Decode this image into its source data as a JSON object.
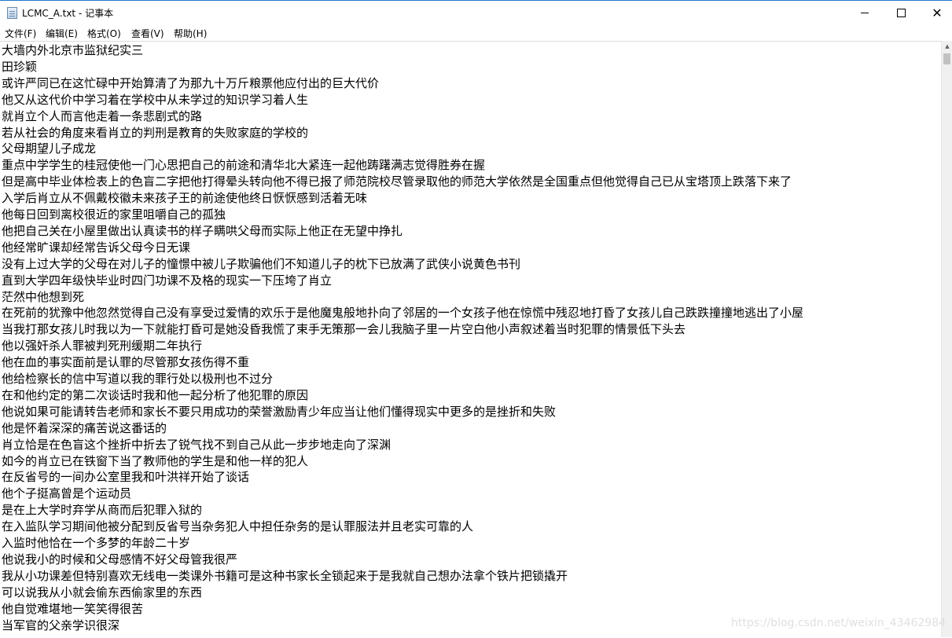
{
  "window": {
    "title": "LCMC_A.txt - 记事本",
    "icon": "notepad-icon",
    "controls": {
      "minimize": "minimize-icon",
      "maximize": "maximize-icon",
      "close": "✕"
    }
  },
  "menu": {
    "items": [
      {
        "label": "文件(F)"
      },
      {
        "label": "编辑(E)"
      },
      {
        "label": "格式(O)"
      },
      {
        "label": "查看(V)"
      },
      {
        "label": "帮助(H)"
      }
    ]
  },
  "editor": {
    "lines": [
      "大墙内外北京市监狱纪实三",
      "田珍颖",
      "或许严同已在这忙碌中开始算清了为那九十万斤粮票他应付出的巨大代价",
      "他又从这代价中学习着在学校中从未学过的知识学习着人生",
      "就肖立个人而言他走着一条悲剧式的路",
      "若从社会的角度来看肖立的判刑是教育的失败家庭的学校的",
      "父母期望儿子成龙",
      "重点中学学生的桂冠使他一门心思把自己的前途和清华北大紧连一起他踌躇满志觉得胜券在握",
      "但是高中毕业体检表上的色盲二字把他打得晕头转向他不得已报了师范院校尽管录取他的师范大学依然是全国重点但他觉得自己已从宝塔顶上跌落下来了",
      "入学后肖立从不佩戴校徽未来孩子王的前途使他终日恹恹感到活着无味",
      "他每日回到离校很近的家里咀嚼自己的孤独",
      "他把自己关在小屋里做出认真读书的样子瞒哄父母而实际上他正在无望中挣扎",
      "他经常旷课却经常告诉父母今日无课",
      "没有上过大学的父母在对儿子的憧憬中被儿子欺骗他们不知道儿子的枕下已放满了武侠小说黄色书刊",
      "直到大学四年级快毕业时四门功课不及格的现实一下压垮了肖立",
      "茫然中他想到死",
      "在死前的犹豫中他忽然觉得自己没有享受过爱情的欢乐于是他魔鬼般地扑向了邻居的一个女孩子他在惊慌中残忍地打昏了女孩儿自己跌跌撞撞地逃出了小屋",
      "当我打那女孩儿时我以为一下就能打昏可是她没昏我慌了束手无策那一会儿我脑子里一片空白他小声叙述着当时犯罪的情景低下头去",
      "他以强奸杀人罪被判死刑缓期二年执行",
      "他在血的事实面前是认罪的尽管那女孩伤得不重",
      "他给检察长的信中写道以我的罪行处以极刑也不过分",
      "在和他约定的第二次谈话时我和他一起分析了他犯罪的原因",
      "他说如果可能请转告老师和家长不要只用成功的荣誉激励青少年应当让他们懂得现实中更多的是挫折和失败",
      "他是怀着深深的痛苦说这番话的",
      "肖立恰是在色盲这个挫折中折去了锐气找不到自己从此一步步地走向了深渊",
      "如今的肖立已在铁窗下当了教师他的学生是和他一样的犯人",
      "在反省号的一间办公室里我和叶洪祥开始了谈话",
      "他个子挺高曾是个运动员",
      "是在上大学时弃学从商而后犯罪入狱的",
      "在入监队学习期间他被分配到反省号当杂务犯人中担任杂务的是认罪服法并且老实可靠的人",
      "入监时他恰在一个多梦的年龄二十岁",
      "他说我小的时候和父母感情不好父母管我很严",
      "我从小功课差但特别喜欢无线电一类课外书籍可是这种书家长全锁起来于是我就自己想办法拿个铁片把锁撬开",
      "可以说我从小就会偷东西偷家里的东西",
      "他自觉难堪地一笑笑得很苦",
      "当军官的父亲学识很深"
    ]
  },
  "watermark": "https://blog.csdn.net/weixin_43462984"
}
